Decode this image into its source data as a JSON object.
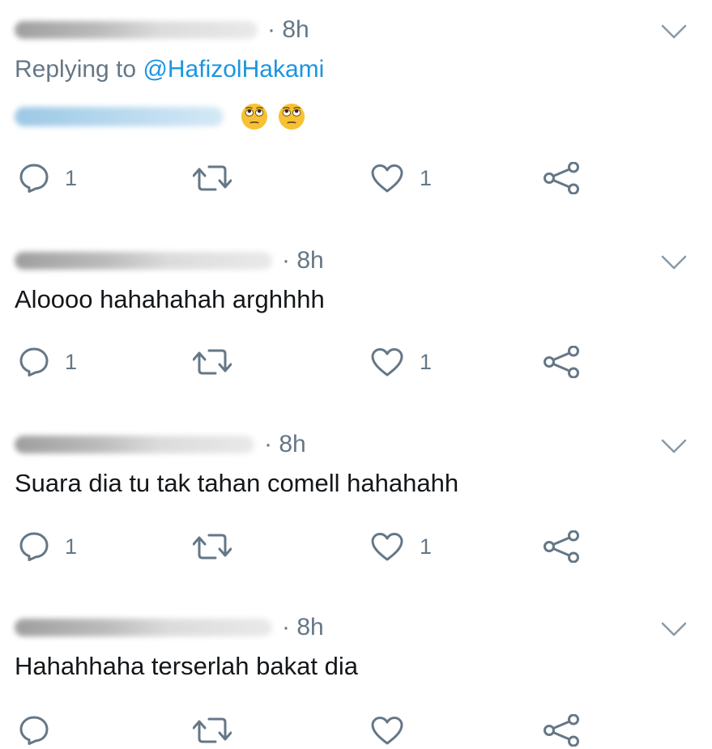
{
  "tweets": [
    {
      "time": "· 8h",
      "reply_prefix": "Replying to",
      "reply_handle": "@HafizolHakami",
      "text": "",
      "reply_count": "1",
      "like_count": "1"
    },
    {
      "time": "· 8h",
      "text": "Aloooo hahahahah arghhhh",
      "reply_count": "1",
      "like_count": "1"
    },
    {
      "time": "· 8h",
      "text": "Suara dia tu tak tahan comell hahahahh",
      "reply_count": "1",
      "like_count": "1"
    },
    {
      "time": "· 8h",
      "text": "Hahahhaha terserlah bakat dia",
      "reply_count": "",
      "like_count": ""
    }
  ],
  "icons": {
    "reply": "reply-icon",
    "retweet": "retweet-icon",
    "like": "heart-icon",
    "share": "share-icon",
    "more": "chevron-down-icon",
    "emoji": "face-with-rolling-eyes-emoji"
  },
  "colors": {
    "text": "#14171a",
    "secondary": "#657786",
    "link": "#1b95e0",
    "emoji": "#f6c234"
  }
}
